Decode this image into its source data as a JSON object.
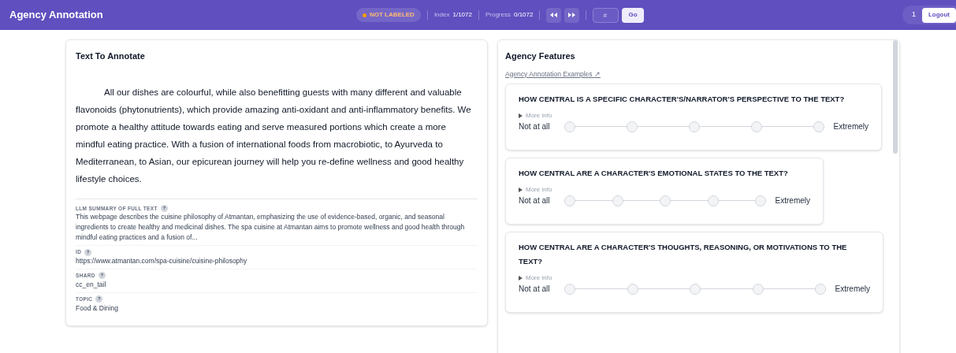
{
  "header": {
    "title": "Agency Annotation",
    "status": {
      "label": "NOT LABELED",
      "color": "#f59e0b"
    },
    "index_label": "Index",
    "index_value": "1/1072",
    "progress_label": "Progress",
    "progress_value": "0/1072",
    "jump_placeholder": "#",
    "go_button": "Go",
    "user_count": "1",
    "logout_button": "Logout"
  },
  "text_panel": {
    "title": "Text To Annotate",
    "body": "All our dishes are colourful, while also benefitting guests with many different and valuable flavonoids (phytonutrients), which provide amazing anti-oxidant and anti-inflammatory benefits. We promote a healthy attitude towards eating and serve measured portions which create a more mindful eating practice. With a fusion of international foods from macrobiotic, to Ayurveda to Mediterranean, to Asian, our epicurean journey will help you re-define wellness and good healthy lifestyle choices.",
    "fields": [
      {
        "label": "LLM SUMMARY OF FULL TEXT",
        "help": "?",
        "value": "This webpage describes the cuisine philosophy of Atmantan, emphasizing the use of evidence-based, organic, and seasonal ingredients to create healthy and medicinal dishes. The spa cuisine at Atmantan aims to promote wellness and good health through mindful eating practices and a fusion of..."
      },
      {
        "label": "ID",
        "help": "?",
        "value": "https://www.atmantan.com/spa-cuisine/cuisine-philosophy"
      },
      {
        "label": "SHARD",
        "help": "?",
        "value": "cc_en_tail"
      },
      {
        "label": "TOPIC",
        "help": "?",
        "value": "Food & Dining"
      }
    ]
  },
  "features_panel": {
    "title": "Agency Features",
    "examples_link": "Agency Annotation Examples ↗",
    "questions": [
      {
        "title": "HOW CENTRAL IS A SPECIFIC CHARACTER'S/NARRATOR'S PERSPECTIVE TO THE TEXT?",
        "more_info": "More info",
        "min_label": "Not at all",
        "max_label": "Extremely",
        "options": [
          {
            "selected": false
          },
          {
            "selected": false
          },
          {
            "selected": false
          },
          {
            "selected": false
          },
          {
            "selected": false
          }
        ]
      },
      {
        "title": "HOW CENTRAL ARE A CHARACTER'S EMOTIONAL STATES TO THE TEXT?",
        "more_info": "More info",
        "min_label": "Not at all",
        "max_label": "Extremely",
        "options": [
          {
            "selected": false
          },
          {
            "selected": false
          },
          {
            "selected": false
          },
          {
            "selected": false
          },
          {
            "selected": false
          }
        ]
      },
      {
        "title": "HOW CENTRAL ARE A CHARACTER'S THOUGHTS, REASONING, OR MOTIVATIONS TO THE TEXT?",
        "more_info": "More info",
        "min_label": "Not at all",
        "max_label": "Extremely",
        "options": [
          {
            "selected": false
          },
          {
            "selected": false
          },
          {
            "selected": false
          },
          {
            "selected": false
          },
          {
            "selected": false
          }
        ]
      }
    ]
  }
}
